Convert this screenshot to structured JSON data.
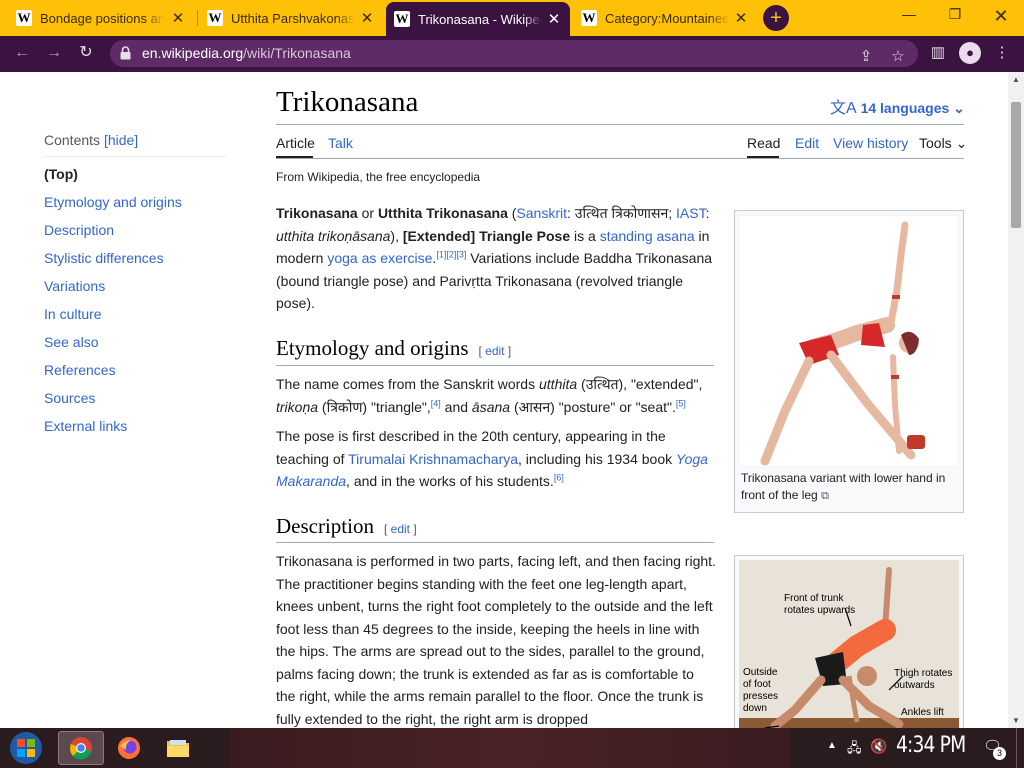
{
  "tabs": [
    {
      "title": "Bondage positions and"
    },
    {
      "title": "Utthita Parshvakonasa"
    },
    {
      "title": "Trikonasana - Wikipedia"
    },
    {
      "title": "Category:Mountaineers"
    }
  ],
  "tab_icon_letter": "W",
  "new_tab_label": "+",
  "url": {
    "domain": "en.wikipedia.org",
    "path": "/wiki/Trikonasana"
  },
  "article": {
    "title": "Trikonasana",
    "languages": "14 languages",
    "tabs": {
      "article": "Article",
      "talk": "Talk",
      "read": "Read",
      "edit": "Edit",
      "view_history": "View history",
      "tools": "Tools"
    },
    "from": "From Wikipedia, the free encyclopedia"
  },
  "toc": {
    "label": "Contents",
    "hide": "[hide]",
    "items": [
      "(Top)",
      "Etymology and origins",
      "Description",
      "Stylistic differences",
      "Variations",
      "In culture",
      "See also",
      "References",
      "Sources",
      "External links"
    ]
  },
  "lead": {
    "t1": "Trikonasana",
    "t2": " or ",
    "t3": "Utthita Trikonasana",
    "t4": " (",
    "sanskrit": "Sanskrit",
    "t5": ": उत्थित त्रिकोणासन; ",
    "iast": "IAST",
    "t6": ": ",
    "t7": "utthita trikoṇāsana",
    "t8": "), ",
    "t9": "[Extended] Triangle Pose",
    "t10": " is a ",
    "standing_asana": "standing asana",
    "t11": " in modern ",
    "yoga": "yoga as exercise",
    "t12": ".",
    "refs": "[1][2][3]",
    "t13": " Variations include Baddha Trikonasana (bound triangle pose) and Parivṛtta Trikonasana (revolved triangle pose)."
  },
  "etymology": {
    "heading": "Etymology and origins",
    "edit": "edit",
    "p1": {
      "a": "The name comes from the Sanskrit words ",
      "b": "utthita",
      "c": " (उत्थित), \"extended\", ",
      "d": "trikoṇa",
      "e": " (त्रिकोण) \"triangle\",",
      "ref4": "[4]",
      "f": " and ",
      "g": "āsana",
      "h": " (आसन) \"posture\" or \"seat\".",
      "ref5": "[5]"
    },
    "p2": {
      "a": "The pose is first described in the 20th century, appearing in the teaching of ",
      "link1": "Tirumalai Krishnamacharya",
      "b": ", including his 1934 book ",
      "link2": "Yoga Makaranda",
      "c": ", and in the works of his students.",
      "ref6": "[6]"
    }
  },
  "description": {
    "heading": "Description",
    "edit": "edit",
    "text": "Trikonasana is performed in two parts, facing left, and then facing right. The practitioner begins standing with the feet one leg-length apart, knees unbent, turns the right foot completely to the outside and the left foot less than 45 degrees to the inside, keeping the heels in line with the hips. The arms are spread out to the sides, parallel to the ground, palms facing down; the trunk is extended as far as is comfortable to the right, while the arms remain parallel to the floor. Once the trunk is fully extended to the right, the right arm is dropped"
  },
  "figure1": {
    "caption": "Trikonasana variant with lower hand in front of the leg"
  },
  "figure2": {
    "labels": {
      "front": "Front of trunk rotates upwards",
      "outside": "Outside of foot presses down",
      "thigh": "Thigh rotates outwards",
      "ankles": "Ankles lift"
    }
  },
  "taskbar": {
    "clock": "4:34 PM",
    "notifications": "3"
  },
  "colors": {
    "tabbar": "#ffc107",
    "toolbar": "#3b1340",
    "link": "#3366cc",
    "taskbar": "#2a1b1f"
  }
}
